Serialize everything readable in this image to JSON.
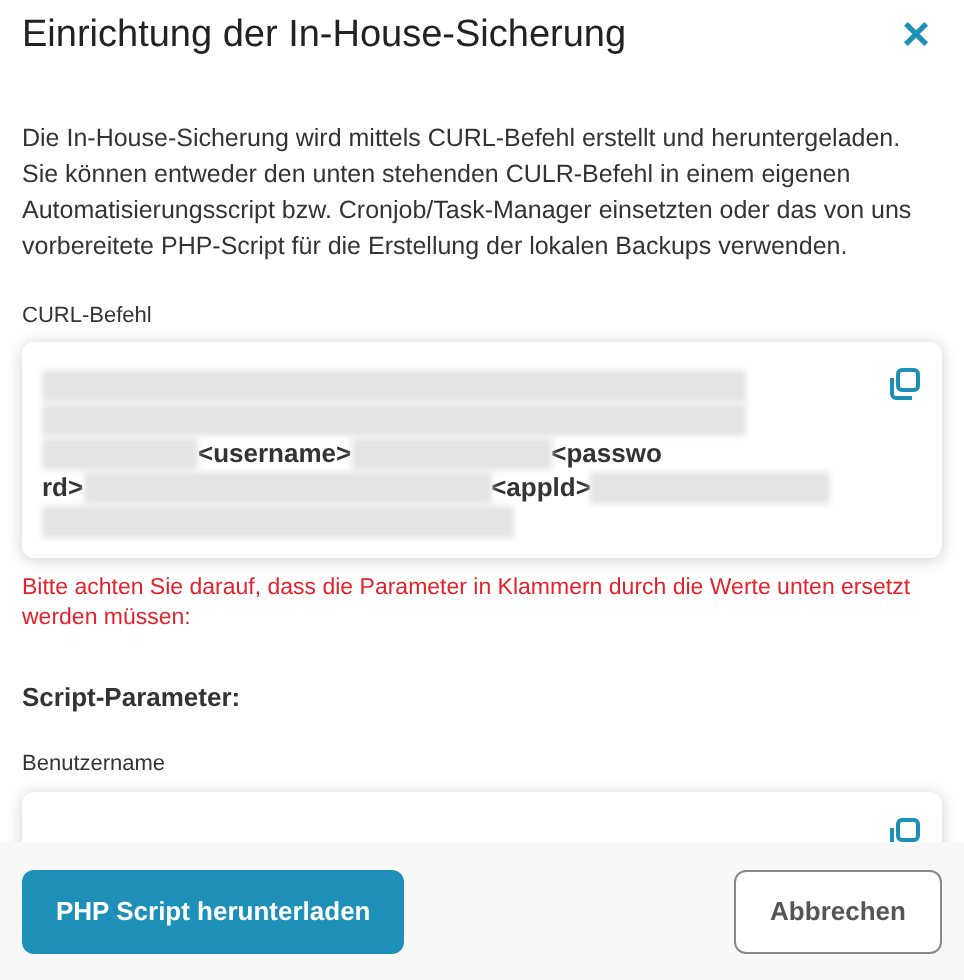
{
  "dialog": {
    "title": "Einrichtung der In-House-Sicherung",
    "close": "×"
  },
  "intro": "Die In-House-Sicherung wird mittels CURL-Befehl erstellt und heruntergeladen. Sie können entweder den unten stehenden CULR-Befehl in einem eigenen Automatisierungsscript bzw. Cronjob/Task-Manager einsetzten oder das von uns vorbereitete PHP-Script für die Erstellung der lokalen Backups verwenden.",
  "curl": {
    "label": "CURL-Befehl",
    "lines": [
      [
        {
          "kind": "redacted"
        }
      ],
      [
        {
          "kind": "redacted"
        }
      ],
      [
        {
          "kind": "redacted"
        },
        {
          "kind": "text",
          "text": "<username>"
        },
        {
          "kind": "redacted"
        },
        {
          "kind": "text",
          "text": "<passwo"
        }
      ],
      [
        {
          "kind": "text",
          "text": "rd>"
        },
        {
          "kind": "redacted"
        },
        {
          "kind": "text",
          "text": "<appld>"
        },
        {
          "kind": "redacted"
        }
      ],
      [
        {
          "kind": "redacted"
        }
      ]
    ],
    "hint": "Bitte achten Sie darauf, dass die Parameter in Klammern durch die Werte unten ersetzt werden müssen:"
  },
  "script_parameters": {
    "heading": "Script-Parameter:",
    "fields": [
      {
        "label": "Benutzername"
      }
    ]
  },
  "footer": {
    "primary": "PHP Script herunterladen",
    "cancel": "Abbrechen"
  }
}
